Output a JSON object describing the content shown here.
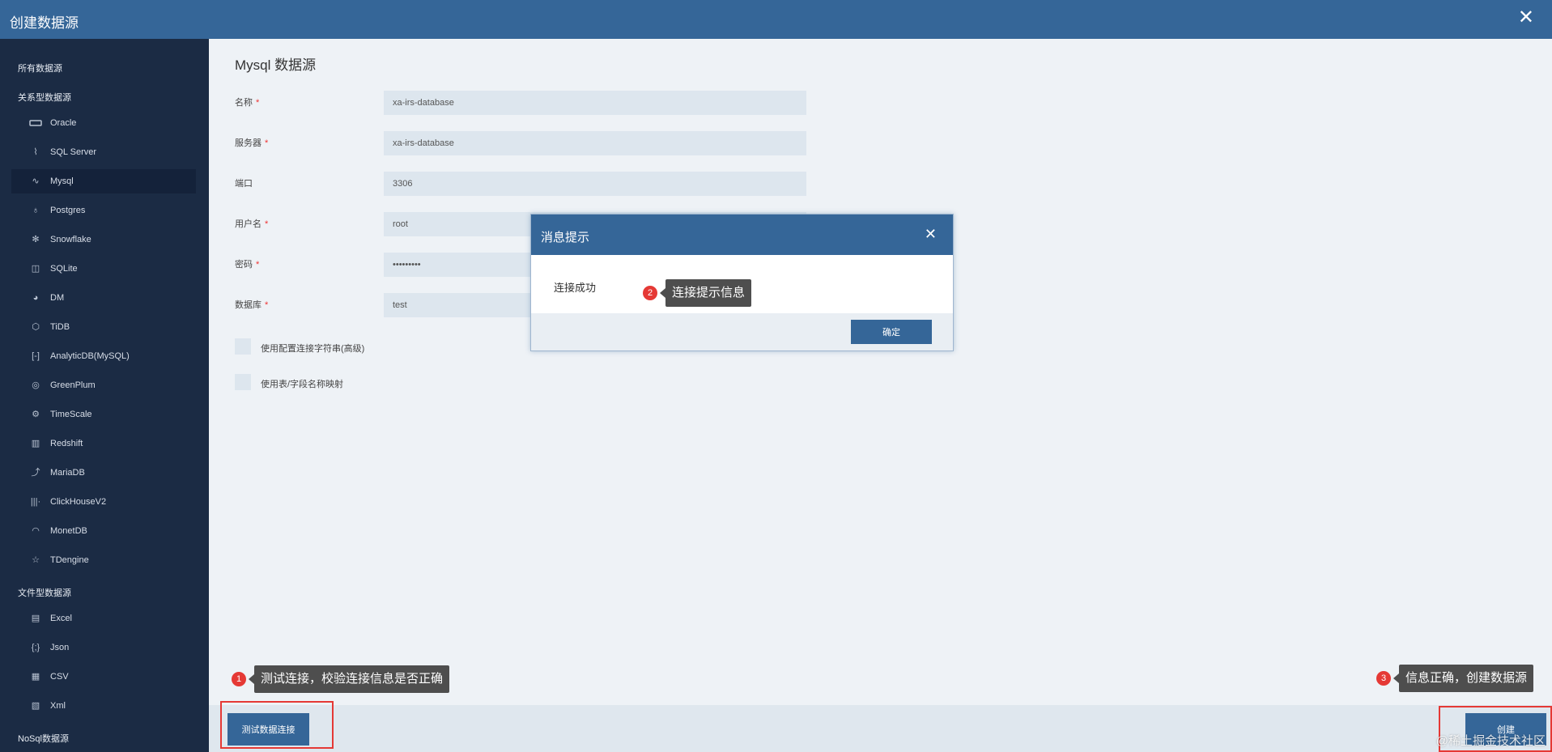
{
  "window": {
    "title": "创建数据源",
    "close_glyph": "✕"
  },
  "sidebar": {
    "groups": {
      "all": "所有数据源",
      "relational": "关系型数据源",
      "file": "文件型数据源",
      "nosql": "NoSql数据源"
    },
    "relational_items": [
      {
        "label": "Oracle",
        "icon": "oracle-icon"
      },
      {
        "label": "SQL Server",
        "icon": "sql-server-icon"
      },
      {
        "label": "Mysql",
        "icon": "mysql-icon",
        "active": true
      },
      {
        "label": "Postgres",
        "icon": "postgres-icon"
      },
      {
        "label": "Snowflake",
        "icon": "snowflake-icon"
      },
      {
        "label": "SQLite",
        "icon": "sqlite-icon"
      },
      {
        "label": "DM",
        "icon": "dm-icon"
      },
      {
        "label": "TiDB",
        "icon": "tidb-icon"
      },
      {
        "label": "AnalyticDB(MySQL)",
        "icon": "analyticdb-icon"
      },
      {
        "label": "GreenPlum",
        "icon": "greenplum-icon"
      },
      {
        "label": "TimeScale",
        "icon": "timescale-icon"
      },
      {
        "label": "Redshift",
        "icon": "redshift-icon"
      },
      {
        "label": "MariaDB",
        "icon": "mariadb-icon"
      },
      {
        "label": "ClickHouseV2",
        "icon": "clickhouse-icon"
      },
      {
        "label": "MonetDB",
        "icon": "monetdb-icon"
      },
      {
        "label": "TDengine",
        "icon": "tdengine-icon"
      }
    ],
    "file_items": [
      {
        "label": "Excel",
        "icon": "excel-icon"
      },
      {
        "label": "Json",
        "icon": "json-icon"
      },
      {
        "label": "CSV",
        "icon": "csv-icon"
      },
      {
        "label": "Xml",
        "icon": "xml-icon"
      }
    ]
  },
  "form": {
    "title": "Mysql 数据源",
    "required_mark": "*",
    "fields": [
      {
        "label": "名称",
        "value": "xa-irs-database",
        "required": true
      },
      {
        "label": "服务器",
        "value": "xa-irs-database",
        "required": true
      },
      {
        "label": "端口",
        "value": "3306",
        "required": false
      },
      {
        "label": "用户名",
        "value": "root",
        "required": true
      },
      {
        "label": "密码",
        "value": "•••••••••",
        "required": true
      },
      {
        "label": "数据库",
        "value": "test",
        "required": true
      }
    ],
    "checkboxes": [
      {
        "label": "使用配置连接字符串(高级)"
      },
      {
        "label": "使用表/字段名称映射"
      }
    ]
  },
  "footer": {
    "test_button": "测试数据连接",
    "create_button": "创建"
  },
  "annotations": [
    {
      "num": "1",
      "text": "测试连接，校验连接信息是否正确"
    },
    {
      "num": "2",
      "text": "连接提示信息"
    },
    {
      "num": "3",
      "text": "信息正确，创建数据源"
    }
  ],
  "dialog": {
    "title": "消息提示",
    "close_glyph": "✕",
    "message": "连接成功",
    "ok_button": "确定"
  },
  "watermark": "@稀土掘金技术社区",
  "colors": {
    "titlebar": "#356698",
    "sidebar": "#1b2b44",
    "content": "#eef2f6",
    "input": "#dde6ee",
    "primary_button": "#356698",
    "required": "#e33333",
    "highlight_box": "#e53935",
    "annotation_bubble": "#4e4e4e"
  }
}
